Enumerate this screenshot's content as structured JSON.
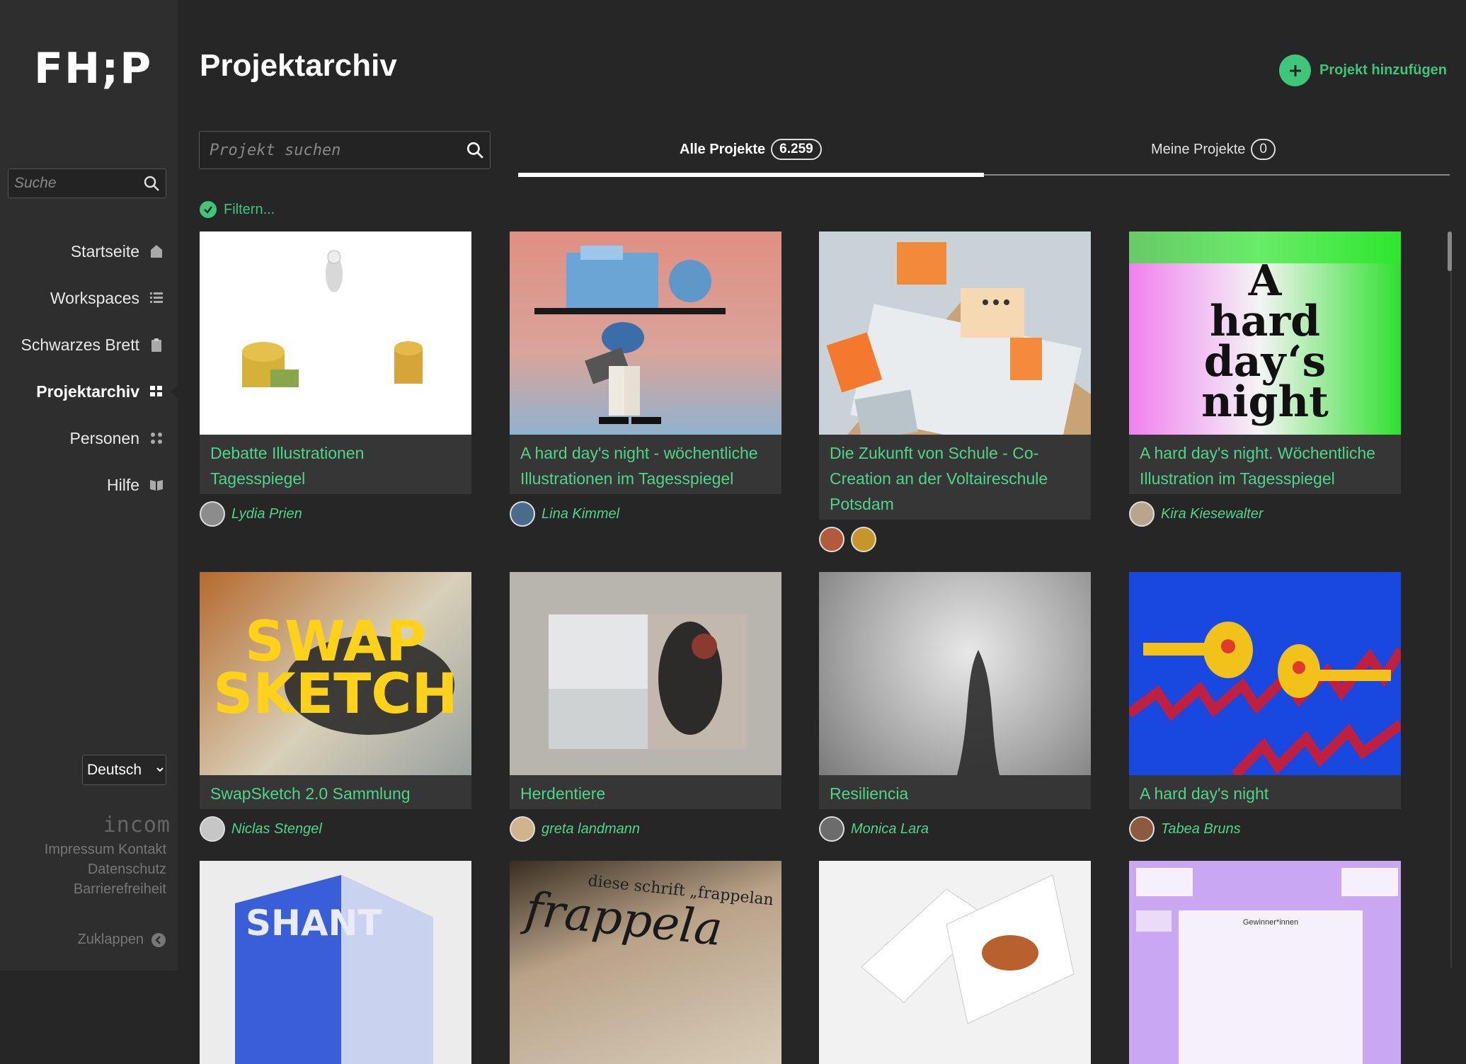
{
  "sidebar": {
    "logo": "FH;P",
    "search_placeholder": "Suche",
    "items": [
      {
        "label": "Startseite",
        "icon": "home-icon"
      },
      {
        "label": "Workspaces",
        "icon": "list-icon"
      },
      {
        "label": "Schwarzes Brett",
        "icon": "clipboard-icon"
      },
      {
        "label": "Projektarchiv",
        "icon": "grid-icon",
        "active": true
      },
      {
        "label": "Personen",
        "icon": "people-icon"
      },
      {
        "label": "Hilfe",
        "icon": "book-icon"
      }
    ],
    "language": "Deutsch",
    "incom": "incom",
    "footer_links": [
      "Impressum",
      "Kontakt",
      "Datenschutz",
      "Barrierefreiheit"
    ],
    "collapse_label": "Zuklappen"
  },
  "header": {
    "title": "Projektarchiv",
    "add_label": "Projekt hinzufügen"
  },
  "search": {
    "placeholder": "Projekt suchen"
  },
  "tabs": [
    {
      "label": "Alle Projekte",
      "count": "6.259",
      "active": true
    },
    {
      "label": "Meine Projekte",
      "count": "0",
      "active": false
    }
  ],
  "filter_label": "Filtern...",
  "projects": [
    {
      "title": "Debatte Illustrationen Tagesspiegel",
      "authors": [
        "Lydia Prien"
      ]
    },
    {
      "title": "A hard day's night - wöchentliche Illustrationen im Tagesspiegel",
      "authors": [
        "Lina Kimmel"
      ]
    },
    {
      "title": "Die Zukunft von Schule - Co-Creation an der Voltaireschule Potsdam",
      "authors": [
        "",
        ""
      ]
    },
    {
      "title": "A hard day's night. Wöchentliche Illustration im Tagesspiegel",
      "authors": [
        "Kira Kiesewalter"
      ],
      "thumb_text": "A hard day‘s night"
    },
    {
      "title": "SwapSketch 2.0 Sammlung",
      "authors": [
        "Niclas Stengel"
      ],
      "thumb_text": "SWAP SKETCH"
    },
    {
      "title": "Herdentiere",
      "authors": [
        "greta landmann"
      ]
    },
    {
      "title": "Resiliencia",
      "authors": [
        "Monica Lara"
      ]
    },
    {
      "title": "A hard day's night",
      "authors": [
        "Tabea Bruns"
      ]
    }
  ],
  "row3_thumbs": [
    {
      "thumb_text": "SHANT"
    },
    {
      "thumb_text": "diese schrift „frappelan"
    },
    {
      "thumb_text": ""
    },
    {
      "thumb_text": "Gewinner*innen"
    }
  ],
  "colors": {
    "accent": "#3ec67a",
    "background": "#262626",
    "sidebar": "#2e2e2e"
  }
}
